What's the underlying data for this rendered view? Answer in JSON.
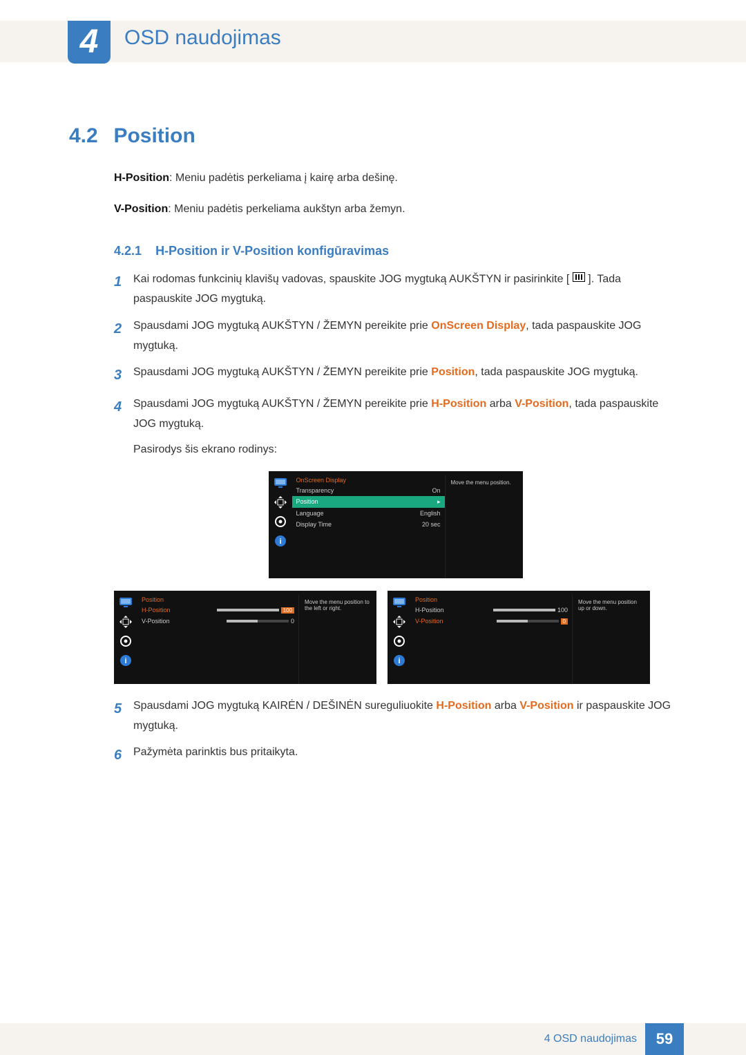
{
  "chapter": {
    "number": "4",
    "title": "OSD naudojimas"
  },
  "section": {
    "number": "4.2",
    "title": "Position"
  },
  "intro": {
    "h_label": "H-Position",
    "h_text": ": Meniu padėtis perkeliama į kairę arba dešinę.",
    "v_label": "V-Position",
    "v_text": ": Meniu padėtis perkeliama aukštyn arba žemyn."
  },
  "subsection": {
    "number": "4.2.1",
    "title": "H-Position ir V-Position konfigūravimas"
  },
  "steps": {
    "s1a": "Kai rodomas funkcinių klavišų vadovas, spauskite JOG mygtuką AUKŠTYN ir pasirinkite [",
    "s1b": "]. Tada paspauskite JOG mygtuką.",
    "s2a": "Spausdami JOG mygtuką AUKŠTYN / ŽEMYN pereikite prie ",
    "s2hl": "OnScreen Display",
    "s2b": ", tada paspauskite JOG mygtuką.",
    "s3a": "Spausdami JOG mygtuką AUKŠTYN / ŽEMYN pereikite prie ",
    "s3hl": "Position",
    "s3b": ", tada paspauskite JOG mygtuką.",
    "s4a": "Spausdami JOG mygtuką AUKŠTYN / ŽEMYN pereikite prie ",
    "s4hl1": "H-Position",
    "s4mid": " arba ",
    "s4hl2": "V-Position",
    "s4b": ", tada paspauskite JOG mygtuką.",
    "s4c": "Pasirodys šis ekrano rodinys:",
    "s5a": "Spausdami JOG mygtuką KAIRĖN / DEŠINĖN sureguliuokite ",
    "s5hl1": "H-Position",
    "s5mid": " arba ",
    "s5hl2": "V-Position",
    "s5b": " ir paspauskite JOG mygtuką.",
    "s6": "Pažymėta parinktis bus pritaikyta."
  },
  "osd1": {
    "title": "OnScreen Display",
    "rows": [
      {
        "label": "Transparency",
        "value": "On"
      },
      {
        "label": "Position",
        "value": "▸",
        "selected": true
      },
      {
        "label": "Language",
        "value": "English"
      },
      {
        "label": "Display Time",
        "value": "20 sec"
      }
    ],
    "hint": "Move the menu position."
  },
  "osd2": {
    "title": "Position",
    "rows": [
      {
        "label": "H-Position",
        "value": "100",
        "slider": 100,
        "selected": true
      },
      {
        "label": "V-Position",
        "value": "0",
        "slider": 50
      }
    ],
    "hint": "Move the menu position to the left or right."
  },
  "osd3": {
    "title": "Position",
    "rows": [
      {
        "label": "H-Position",
        "value": "100",
        "slider": 100
      },
      {
        "label": "V-Position",
        "value": "0",
        "slider": 50,
        "selected": true
      }
    ],
    "hint": "Move the menu position up or down."
  },
  "footer": {
    "text": "4 OSD naudojimas",
    "page": "59"
  }
}
